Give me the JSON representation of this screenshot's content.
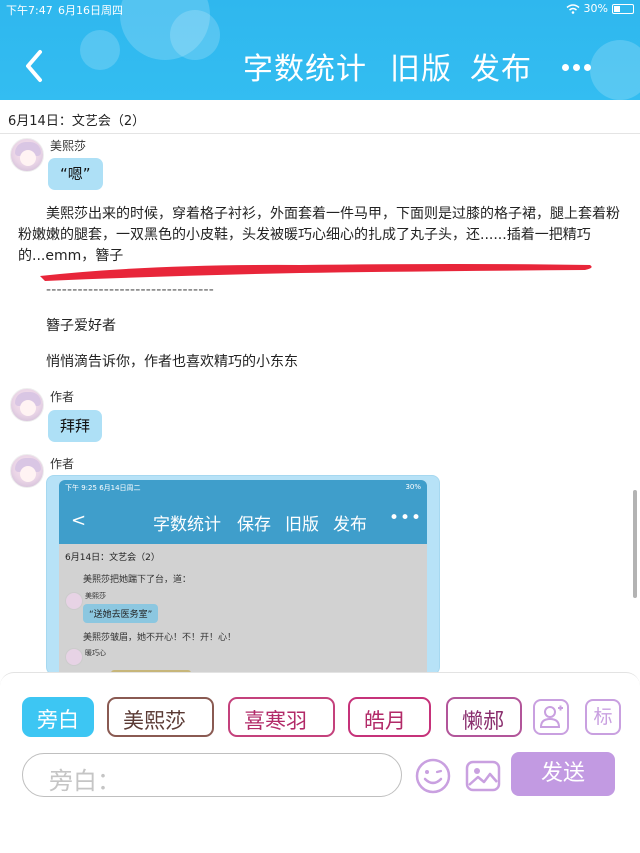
{
  "status_bar": {
    "time": "下午7:47",
    "date": "6月16日周四",
    "battery": "30%"
  },
  "header": {
    "word_count": "字数统计",
    "old_version": "旧版",
    "publish": "发布"
  },
  "chapter_title": "6月14日：文艺会（2）",
  "messages": {
    "first_speaker": "美熙莎",
    "first_bubble": "“嗯”",
    "narration_1": "美熙莎出来的时候，穿着格子衬衫，外面套着一件马甲，下面则是过膝的格子裙，腿上套着粉粉嫩嫩的腿套，一双黑色的小皮鞋，头发被暖巧心细心的扎成了丸子头，还......插着一把精巧的...emm，簪子",
    "dashes": "--------------------------------",
    "narration_2": "簪子爱好者",
    "narration_3": "悄悄滴告诉你，作者也喜欢精巧的小东东",
    "second_speaker": "作者",
    "second_bubble": "拜拜",
    "third_speaker": "作者"
  },
  "embedded": {
    "status_time": "下午 9:25",
    "status_date": "6月14日周二",
    "status_battery": "30%",
    "word_count": "字数统计",
    "save": "保存",
    "old_version": "旧版",
    "publish": "发布",
    "chapter_title": "6月14日：文艺会（2）",
    "line_1": "美熙莎把她踹下了台，道：",
    "speaker_1": "美熙莎",
    "bubble_1": "“送她去医务室”",
    "line_2": "美熙莎皱眉，她不开心！不！开！心！",
    "speaker_2": "暖巧心"
  },
  "bottom": {
    "chips": [
      "旁白",
      "美熙莎",
      "喜寒羽",
      "皓月",
      "懒郝"
    ],
    "mark_label": "标",
    "input_placeholder": "旁白：",
    "send": "发送"
  },
  "colors": {
    "header_blue": "#2fb7ee",
    "bubble_blue": "#aee0f6",
    "send_purple": "#c29ae2",
    "highlight_red": "#e8263a"
  },
  "icons": [
    "back-icon",
    "more-icon",
    "wifi-icon",
    "battery-icon",
    "add-character-icon",
    "emoji-icon",
    "image-icon"
  ]
}
